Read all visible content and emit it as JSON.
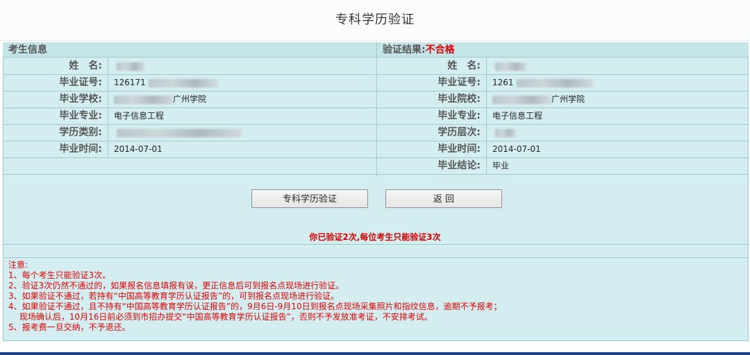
{
  "page": {
    "title": "专科学历验证"
  },
  "left": {
    "header": "考生信息",
    "rows": [
      {
        "label": "姓　名:",
        "value": "",
        "blurred": true,
        "blur_w": 40
      },
      {
        "label": "毕业证号:",
        "value": "126171",
        "blurred": true,
        "blur_w": 100
      },
      {
        "label": "毕业学校:",
        "value": "广州学院",
        "blurred_prefix": true,
        "blur_w": 85
      },
      {
        "label": "毕业专业:",
        "value": "电子信息工程",
        "blurred": false
      },
      {
        "label": "学历类别:",
        "value": "",
        "blurred": true,
        "blur_w": 180
      },
      {
        "label": "毕业时间:",
        "value": "2014-07-01",
        "blurred": false
      }
    ]
  },
  "right": {
    "header": "验证结果:",
    "result": "不合格",
    "rows": [
      {
        "label": "姓　名:",
        "value": "",
        "blurred": true,
        "blur_w": 45
      },
      {
        "label": "毕业证号:",
        "value": "1261",
        "blurred": true,
        "blur_w": 110
      },
      {
        "label": "毕业院校:",
        "value": "广州学院",
        "blurred_prefix": true,
        "blur_w": 85
      },
      {
        "label": "毕业专业:",
        "value": "电子信息工程",
        "blurred": false
      },
      {
        "label": "学历层次:",
        "value": "",
        "blurred": true,
        "blur_w": 30
      },
      {
        "label": "毕业时间:",
        "value": "2014-07-01",
        "blurred": false
      },
      {
        "label": "毕业结论:",
        "value": "毕业",
        "blurred": false
      }
    ]
  },
  "buttons": {
    "verify": "专科学历验证",
    "back": "返  回"
  },
  "warning": "你已验证2次,每位考生只能验证3次",
  "notes": {
    "title": "注意:",
    "items": [
      "1、每个考生只能验证3次。",
      "2、验证3次仍然不通过的，如果报名信息填报有误，更正信息后可到报名点现场进行验证。",
      "3、如果验证不通过，若持有“中国高等教育学历认证报告”的，可到报名点现场进行验证。",
      "4、如果验证不通过，且不持有“中国高等教育学历认证报告”的，9月6日-9月10日到报名点现场采集照片和指纹信息，逾期不予报考；",
      "　 现场确认后，10月16日前必须到市招办提交“中国高等教育学历认证报告”，否则不予发放准考证，不安排考试。",
      "5、报考费一旦交纳，不予退还。"
    ]
  },
  "colors": {
    "panel_bg": "#d3edf0",
    "border": "#9fc9cd",
    "alert_red": "#e00000",
    "footer": "#1b3f8b"
  }
}
